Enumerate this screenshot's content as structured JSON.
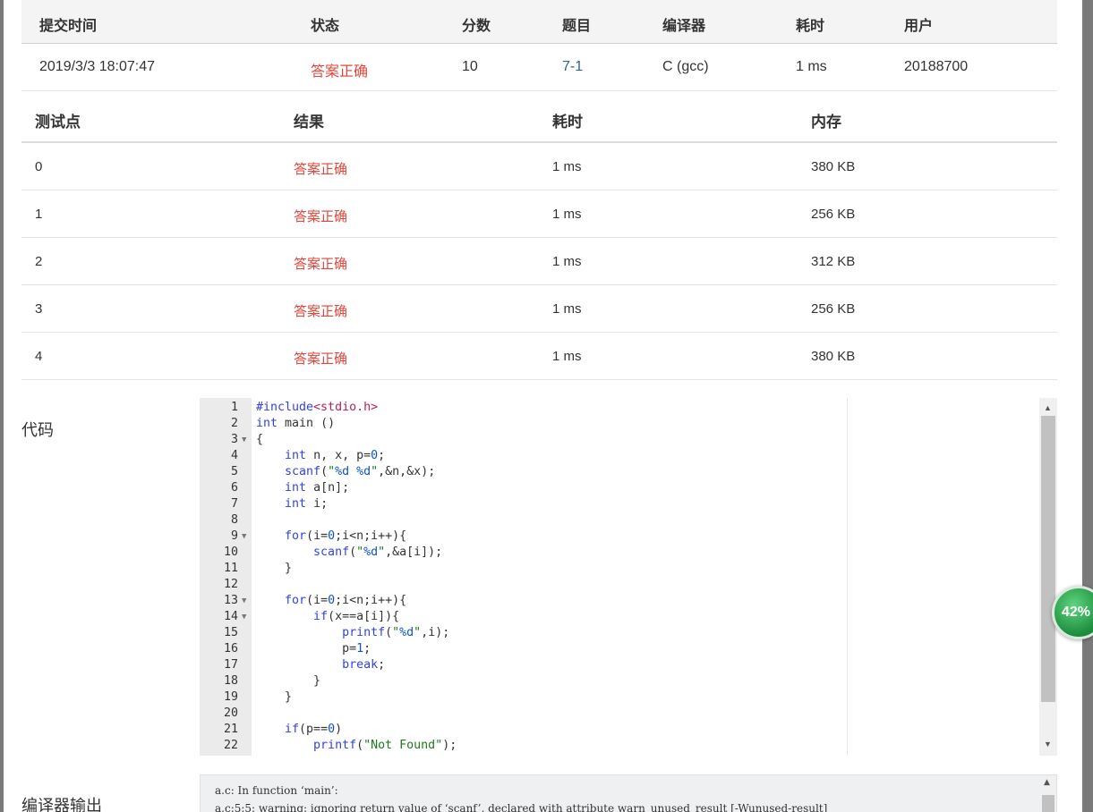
{
  "submission": {
    "headers": [
      "提交时间",
      "状态",
      "分数",
      "题目",
      "编译器",
      "耗时",
      "用户"
    ],
    "row": {
      "time": "2019/3/3 18:07:47",
      "status": "答案正确",
      "score": "10",
      "problem": "7-1",
      "compiler": "C (gcc)",
      "duration": "1 ms",
      "user": "20188700"
    }
  },
  "testcases": {
    "headers": [
      "测试点",
      "结果",
      "耗时",
      "内存"
    ],
    "rows": [
      {
        "id": "0",
        "result": "答案正确",
        "time": "1 ms",
        "memory": "380 KB"
      },
      {
        "id": "1",
        "result": "答案正确",
        "time": "1 ms",
        "memory": "256 KB"
      },
      {
        "id": "2",
        "result": "答案正确",
        "time": "1 ms",
        "memory": "312 KB"
      },
      {
        "id": "3",
        "result": "答案正确",
        "time": "1 ms",
        "memory": "256 KB"
      },
      {
        "id": "4",
        "result": "答案正确",
        "time": "1 ms",
        "memory": "380 KB"
      }
    ]
  },
  "code": {
    "label": "代码",
    "lines": [
      "#include<stdio.h>",
      "int main ()",
      "{",
      "    int n, x, p=0;",
      "    scanf(\"%d %d\",&n,&x);",
      "    int a[n];",
      "    int i;",
      "",
      "    for(i=0;i<n;i++){",
      "        scanf(\"%d\",&a[i]);",
      "    }",
      "",
      "    for(i=0;i<n;i++){",
      "        if(x==a[i]){",
      "            printf(\"%d\",i);",
      "            p=1;",
      "            break;",
      "        }",
      "    }",
      "",
      "    if(p==0)",
      "        printf(\"Not Found\");"
    ],
    "fold_lines": [
      3,
      9,
      13,
      14
    ]
  },
  "compiler_output": {
    "label": "编译器输出",
    "lines": [
      "a.c: In function ‘main’:",
      "a.c:5:5: warning: ignoring return value of ‘scanf’, declared with attribute warn_unused_result [-Wunused-result]"
    ]
  },
  "progress_badge": {
    "text": "42%",
    "value": 42
  }
}
